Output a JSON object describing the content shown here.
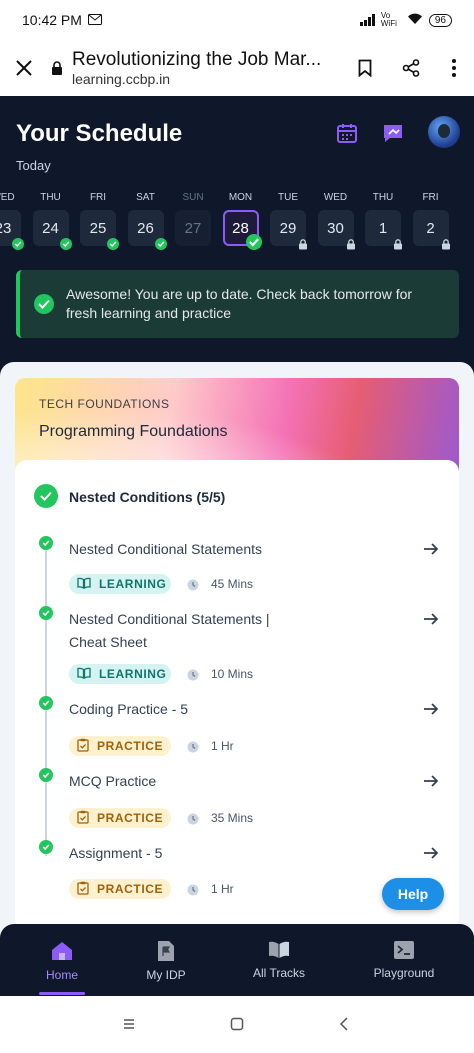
{
  "status_bar": {
    "time": "10:42 PM",
    "network": "Vo WiFi",
    "battery": "96"
  },
  "browser": {
    "page_title": "Revolutionizing the Job Mar...",
    "url": "learning.ccbp.in"
  },
  "schedule": {
    "title": "Your Schedule",
    "subtitle": "Today",
    "days": [
      {
        "name": "WED",
        "date": "23",
        "status": "done"
      },
      {
        "name": "THU",
        "date": "24",
        "status": "done"
      },
      {
        "name": "FRI",
        "date": "25",
        "status": "done"
      },
      {
        "name": "SAT",
        "date": "26",
        "status": "done"
      },
      {
        "name": "SUN",
        "date": "27",
        "status": "off"
      },
      {
        "name": "MON",
        "date": "28",
        "status": "today"
      },
      {
        "name": "TUE",
        "date": "29",
        "status": "locked"
      },
      {
        "name": "WED",
        "date": "30",
        "status": "locked"
      },
      {
        "name": "THU",
        "date": "1",
        "status": "locked"
      },
      {
        "name": "FRI",
        "date": "2",
        "status": "locked"
      }
    ]
  },
  "alert": {
    "message": "Awesome! You are up to date. Check back tomorrow for fresh learning and practice"
  },
  "course": {
    "category": "TECH FOUNDATIONS",
    "name": "Programming Foundations",
    "unit_title": "Nested Conditions (5/5)",
    "items": [
      {
        "title": "Nested Conditional Statements",
        "tag": "LEARNING",
        "duration": "45 Mins"
      },
      {
        "title": "Nested Conditional Statements | Cheat Sheet",
        "tag": "LEARNING",
        "duration": "10 Mins"
      },
      {
        "title": "Coding Practice - 5",
        "tag": "PRACTICE",
        "duration": "1 Hr"
      },
      {
        "title": "MCQ Practice",
        "tag": "PRACTICE",
        "duration": "35 Mins"
      },
      {
        "title": "Assignment - 5",
        "tag": "PRACTICE",
        "duration": "1 Hr"
      }
    ]
  },
  "help_label": "Help",
  "bottom_nav": [
    {
      "label": "Home",
      "icon": "home-icon",
      "active": true
    },
    {
      "label": "My IDP",
      "icon": "flag-document-icon",
      "active": false
    },
    {
      "label": "All Tracks",
      "icon": "book-icon",
      "active": false
    },
    {
      "label": "Playground",
      "icon": "terminal-icon",
      "active": false
    }
  ],
  "colors": {
    "accent": "#8b5cf6",
    "success": "#22c55e",
    "background": "#0f172a",
    "help": "#1d8fe6"
  }
}
